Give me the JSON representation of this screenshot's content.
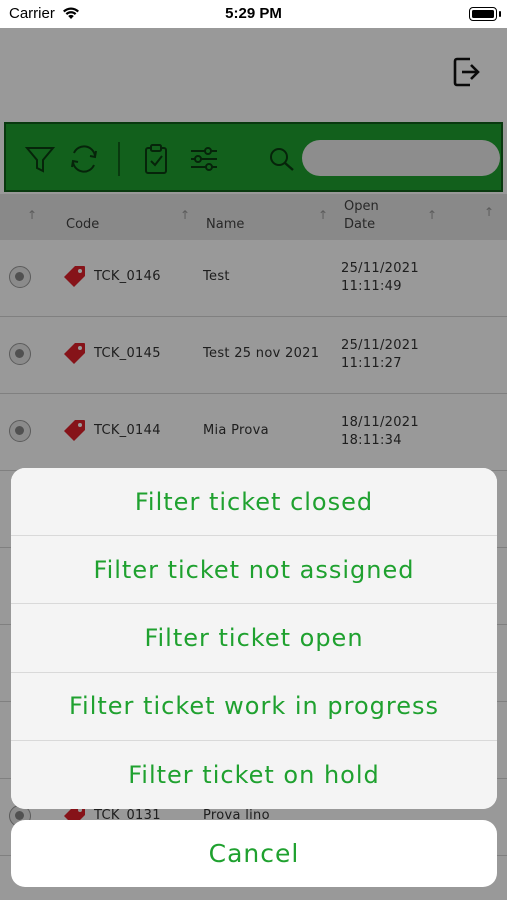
{
  "status_bar": {
    "carrier": "Carrier",
    "time": "5:29 PM"
  },
  "toolbar": {
    "icons": [
      "filter-icon",
      "refresh-icon",
      "clipboard-check-icon",
      "sliders-icon",
      "search-icon"
    ],
    "search_value": "",
    "accent_color": "#1fa12f"
  },
  "table": {
    "columns": {
      "code": "Code",
      "name": "Name",
      "open_date_line1": "Open",
      "open_date_line2": "Date"
    },
    "rows": [
      {
        "code": "TCK_0146",
        "name": "Test",
        "date": "25/11/2021",
        "time": "11:11:49"
      },
      {
        "code": "TCK_0145",
        "name": "Test 25 nov 2021",
        "date": "25/11/2021",
        "time": "11:11:27"
      },
      {
        "code": "TCK_0144",
        "name": "Mia Prova",
        "date": "18/11/2021",
        "time": "18:11:34"
      },
      {
        "code": "TCK_0131",
        "name": "Prova lino",
        "date": "",
        "time": ""
      }
    ]
  },
  "action_sheet": {
    "options": [
      "Filter ticket closed",
      "Filter ticket not assigned",
      "Filter ticket open",
      "Filter ticket work in progress",
      "Filter ticket on hold"
    ],
    "cancel": "Cancel"
  }
}
